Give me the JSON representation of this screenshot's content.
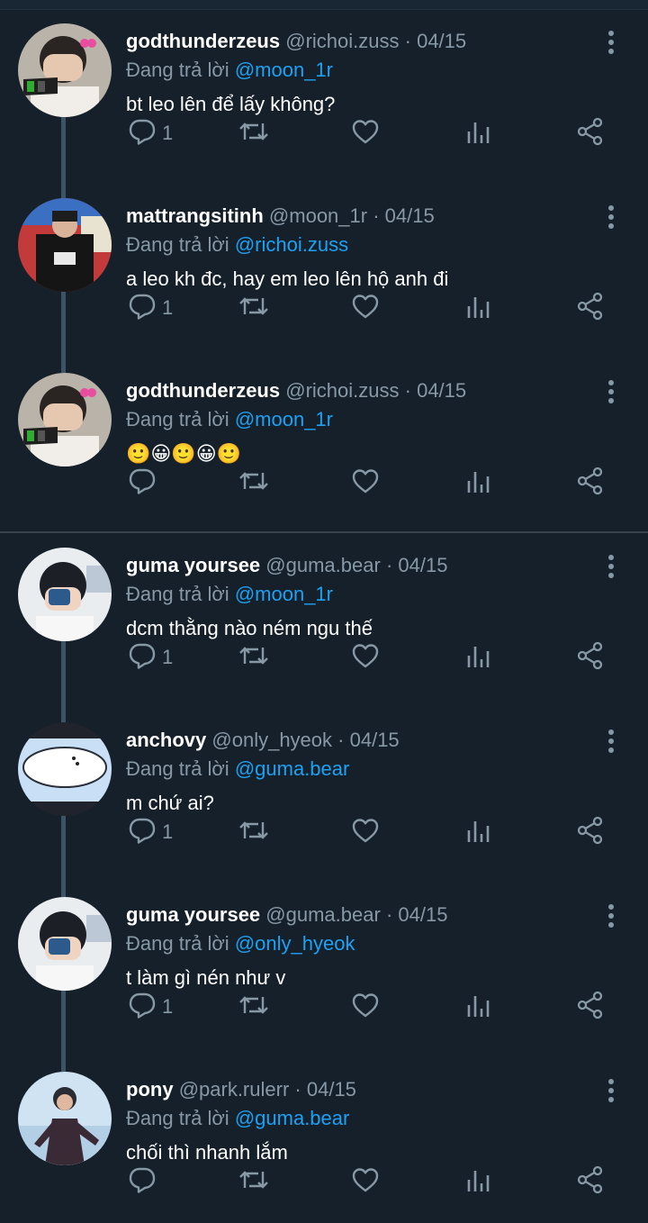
{
  "reply_prefix": "Đang trả lời",
  "colors": {
    "background": "#15202b",
    "muted": "#8899a6",
    "link": "#1da1f2",
    "thread": "#3d5466"
  },
  "icons": {
    "reply": "reply-icon",
    "retweet": "retweet-icon",
    "like": "heart-icon",
    "views": "bar-chart-icon",
    "share": "share-icon",
    "more": "more-vertical-icon"
  },
  "tweets": [
    {
      "name": "godthunderzeus",
      "handle": "@richoi.zuss",
      "date": "04/15",
      "reply_to": "@moon_1r",
      "text": "bt leo lên để lấy không?",
      "replies": "1"
    },
    {
      "name": "mattrangsitinh",
      "handle": "@moon_1r",
      "date": "04/15",
      "reply_to": "@richoi.zuss",
      "text": "a leo kh đc, hay em leo lên hộ anh đi",
      "replies": "1"
    },
    {
      "name": "godthunderzeus",
      "handle": "@richoi.zuss",
      "date": "04/15",
      "reply_to": "@moon_1r",
      "text": "🙂😀🙂😀🙂",
      "replies": ""
    },
    {
      "name": "guma yoursee",
      "handle": "@guma.bear",
      "date": "04/15",
      "reply_to": "@moon_1r",
      "text": "dcm thằng nào ném ngu thế",
      "replies": "1"
    },
    {
      "name": "anchovy",
      "handle": "@only_hyeok",
      "date": "04/15",
      "reply_to": "@guma.bear",
      "text": "m chứ ai?",
      "replies": "1"
    },
    {
      "name": "guma yoursee",
      "handle": "@guma.bear",
      "date": "04/15",
      "reply_to": "@only_hyeok",
      "text": "t làm gì nén như v",
      "replies": "1"
    },
    {
      "name": "pony",
      "handle": "@park.rulerr",
      "date": "04/15",
      "reply_to": "@guma.bear",
      "text": "chối thì nhanh lắm",
      "replies": ""
    }
  ]
}
